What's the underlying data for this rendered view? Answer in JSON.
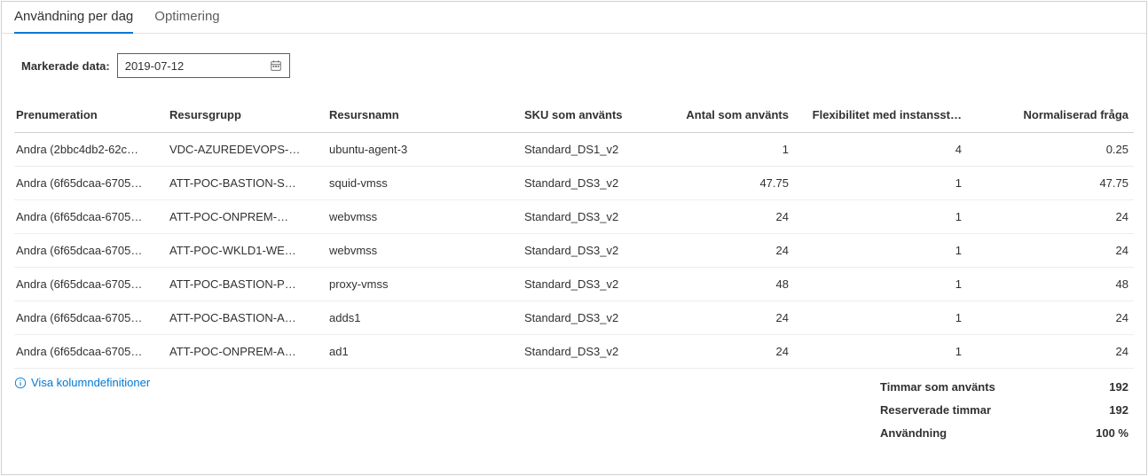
{
  "tabs": {
    "active": "Användning per dag",
    "inactive": "Optimering"
  },
  "filter": {
    "label": "Markerade data:",
    "date_value": "2019-07-12"
  },
  "columns": {
    "c1": "Prenumeration",
    "c2": "Resursgrupp",
    "c3": "Resursnamn",
    "c4": "SKU som använts",
    "c5": "Antal som använts",
    "c6": "Flexibilitet med instansst…",
    "c7": "Normaliserad fråga"
  },
  "rows": [
    {
      "sub": "Andra (2bbc4db2-62c…",
      "rg": "VDC-AZUREDEVOPS-…",
      "rn": "ubuntu-agent-3",
      "sku": "Standard_DS1_v2",
      "amt": "1",
      "flex": "4",
      "norm": "0.25"
    },
    {
      "sub": "Andra (6f65dcaa-6705…",
      "rg": "ATT-POC-BASTION-S…",
      "rn": "squid-vmss",
      "sku": "Standard_DS3_v2",
      "amt": "47.75",
      "flex": "1",
      "norm": "47.75"
    },
    {
      "sub": "Andra (6f65dcaa-6705…",
      "rg": "ATT-POC-ONPREM-…",
      "rn": "webvmss",
      "sku": "Standard_DS3_v2",
      "amt": "24",
      "flex": "1",
      "norm": "24"
    },
    {
      "sub": "Andra (6f65dcaa-6705…",
      "rg": "ATT-POC-WKLD1-WE…",
      "rn": "webvmss",
      "sku": "Standard_DS3_v2",
      "amt": "24",
      "flex": "1",
      "norm": "24"
    },
    {
      "sub": "Andra (6f65dcaa-6705…",
      "rg": "ATT-POC-BASTION-P…",
      "rn": "proxy-vmss",
      "sku": "Standard_DS3_v2",
      "amt": "48",
      "flex": "1",
      "norm": "48"
    },
    {
      "sub": "Andra (6f65dcaa-6705…",
      "rg": "ATT-POC-BASTION-A…",
      "rn": "adds1",
      "sku": "Standard_DS3_v2",
      "amt": "24",
      "flex": "1",
      "norm": "24"
    },
    {
      "sub": "Andra (6f65dcaa-6705…",
      "rg": "ATT-POC-ONPREM-A…",
      "rn": "ad1",
      "sku": "Standard_DS3_v2",
      "amt": "24",
      "flex": "1",
      "norm": "24"
    }
  ],
  "footer_link": "Visa kolumndefinitioner",
  "summary": {
    "used_hours_label": "Timmar som använts",
    "used_hours_value": "192",
    "reserved_hours_label": "Reserverade timmar",
    "reserved_hours_value": "192",
    "usage_label": "Användning",
    "usage_value": "100 %"
  }
}
